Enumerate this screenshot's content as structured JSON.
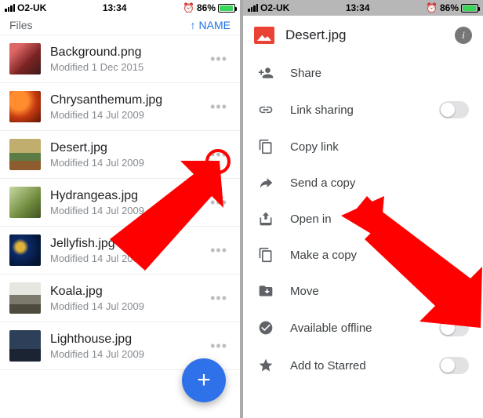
{
  "status": {
    "carrier": "O2-UK",
    "time": "13:34",
    "battery_pct": "86%"
  },
  "left": {
    "section_label": "Files",
    "sort_label": "NAME",
    "files": [
      {
        "name": "Background.png",
        "sub": "Modified 1 Dec 2015"
      },
      {
        "name": "Chrysanthemum.jpg",
        "sub": "Modified 14 Jul 2009"
      },
      {
        "name": "Desert.jpg",
        "sub": "Modified 14 Jul 2009"
      },
      {
        "name": "Hydrangeas.jpg",
        "sub": "Modified 14 Jul 2009"
      },
      {
        "name": "Jellyfish.jpg",
        "sub": "Modified 14 Jul 2009"
      },
      {
        "name": "Koala.jpg",
        "sub": "Modified 14 Jul 2009"
      },
      {
        "name": "Lighthouse.jpg",
        "sub": "Modified 14 Jul 2009"
      }
    ]
  },
  "right": {
    "title": "Desert.jpg",
    "actions": {
      "share": "Share",
      "link": "Link sharing",
      "copylnk": "Copy link",
      "sendcpy": "Send a copy",
      "openin": "Open in",
      "makecpy": "Make a copy",
      "move": "Move",
      "offline": "Available offline",
      "star": "Add to Starred"
    }
  }
}
